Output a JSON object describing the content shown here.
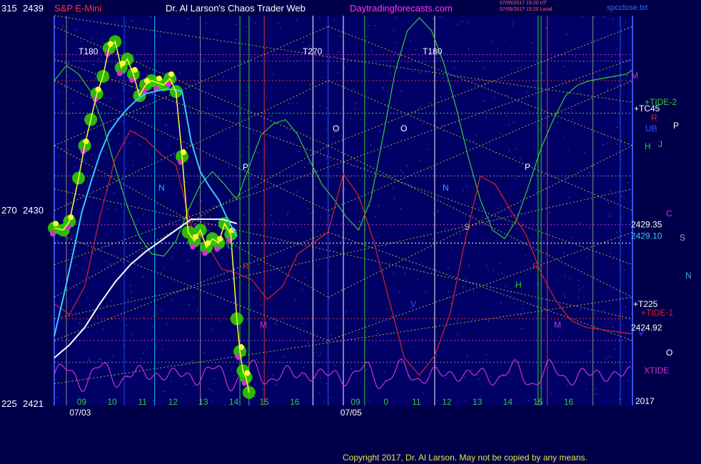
{
  "header": {
    "left_axis_top": "315",
    "price_top": "2439",
    "instrument": "S&P E-Mini",
    "title": "Dr. Al Larson's Chaos Trader Web",
    "site": "Daytradingforecasts.com",
    "timestamp_line1": "07/05/2017 19:20 UT",
    "timestamp_line2": "07/05/2017 15:20 Local",
    "filename": "spcclose.txt"
  },
  "footer": {
    "copyright": "Copyright 2017, Dr. Al Larson. May not be copied by any means.",
    "year": "2017"
  },
  "colors": {
    "background": "#00004a",
    "plot_bg": "#000066",
    "price_fill": "#33cc00",
    "price_line": "#ffff33",
    "avg_line": "#33ccff",
    "envelope": "#ffffff",
    "forecast": "#33cc33",
    "red_line": "#dd2222",
    "xtide": "#cc33cc",
    "grid_yellow": "#dddd22"
  },
  "chart_data": {
    "type": "line",
    "x_labels": [
      "09",
      "10",
      "11",
      "12",
      "13",
      "14",
      "15",
      "16",
      "09",
      "0",
      "11",
      "12",
      "13",
      "14",
      "15",
      "16"
    ],
    "date_labels": [
      "07/03",
      "07/05"
    ],
    "ylim": [
      2421,
      2439
    ],
    "left_axis": {
      "top": "315",
      "mid": "270",
      "bottom": "225"
    },
    "y_ticks": [
      {
        "value": 2439,
        "label": "2439",
        "left": "315"
      },
      {
        "value": 2430,
        "label": "2430",
        "left": "270"
      },
      {
        "value": 2421,
        "label": "2421",
        "left": "225"
      }
    ],
    "price_levels": [
      {
        "value": 2429.35,
        "label": "2429.35",
        "color": "#ffffff"
      },
      {
        "value": 2429.1,
        "label": "2429.10",
        "color": "#33ccff"
      },
      {
        "value": 2424.92,
        "label": "2424.92",
        "color": "#ffffff"
      }
    ],
    "right_labels": [
      {
        "text": "M",
        "color": "#cc33cc"
      },
      {
        "text": "+TIDE-2",
        "color": "#33cc33"
      },
      {
        "text": "+TC45",
        "color": "#ffffff"
      },
      {
        "text": "R",
        "color": "#dd2222"
      },
      {
        "text": "UB",
        "color": "#3355ff"
      },
      {
        "text": "P",
        "color": "#ffffff"
      },
      {
        "text": "H",
        "color": "#33cc33"
      },
      {
        "text": "J",
        "color": "#33cc33"
      },
      {
        "text": "C",
        "color": "#cc33cc"
      },
      {
        "text": "S",
        "color": "#aaaaaa"
      },
      {
        "text": "N",
        "color": "#33aaff"
      },
      {
        "text": "+T225",
        "color": "#ffffff"
      },
      {
        "text": "+TIDE-1",
        "color": "#dd2222"
      },
      {
        "text": "V",
        "color": "#3355ff"
      },
      {
        "text": "O",
        "color": "#ffffff"
      },
      {
        "text": "XTIDE",
        "color": "#cc33cc"
      }
    ],
    "plot_labels": [
      {
        "text": "T180",
        "color": "#ffffff"
      },
      {
        "text": "T270",
        "color": "#ffffff"
      },
      {
        "text": "T180",
        "color": "#ffffff"
      },
      {
        "text": "O",
        "color": "#ffffff"
      },
      {
        "text": "O",
        "color": "#ffffff"
      },
      {
        "text": "N",
        "color": "#33aaff"
      },
      {
        "text": "N",
        "color": "#33aaff"
      },
      {
        "text": "P",
        "color": "#ffffff"
      },
      {
        "text": "P",
        "color": "#ffffff"
      },
      {
        "text": "S",
        "color": "#aaaaaa"
      },
      {
        "text": "R",
        "color": "#dd2222"
      },
      {
        "text": "R",
        "color": "#dd2222"
      },
      {
        "text": "M",
        "color": "#cc33cc"
      },
      {
        "text": "M",
        "color": "#cc33cc"
      },
      {
        "text": "H",
        "color": "#33cc33"
      },
      {
        "text": "U",
        "color": "#33cc33"
      },
      {
        "text": "V",
        "color": "#3355ff"
      }
    ],
    "series": [
      {
        "key": "price",
        "x": [
          0.0,
          0.3,
          0.5,
          0.8,
          1.0,
          1.2,
          1.4,
          1.6,
          1.8,
          2.0,
          2.2,
          2.4,
          2.6,
          2.8,
          3.0,
          3.2,
          3.4,
          3.6,
          3.8,
          4.0,
          4.2,
          4.4,
          4.6,
          4.8,
          5.0,
          5.2,
          5.4,
          5.6,
          5.8,
          6.0,
          6.1,
          6.2,
          6.3,
          6.4
        ],
        "y": [
          2429.2,
          2429.1,
          2429.5,
          2431.5,
          2433.0,
          2434.2,
          2435.4,
          2436.2,
          2437.5,
          2437.8,
          2436.6,
          2437.0,
          2436.3,
          2435.3,
          2435.8,
          2436.0,
          2435.9,
          2435.8,
          2436.1,
          2435.5,
          2432.5,
          2429.0,
          2428.6,
          2429.1,
          2428.3,
          2428.7,
          2428.5,
          2429.4,
          2428.9,
          2425.0,
          2423.5,
          2422.6,
          2422.3,
          2421.6
        ]
      },
      {
        "key": "average",
        "x": [
          0.0,
          0.3,
          0.6,
          0.9,
          1.2,
          1.5,
          1.8,
          2.1,
          2.4,
          2.7,
          3.0,
          3.3,
          3.6,
          3.9,
          4.2,
          4.5,
          4.8,
          5.1,
          5.4,
          5.7,
          6.0
        ],
        "y": [
          2424.2,
          2426.0,
          2427.9,
          2429.9,
          2431.3,
          2432.6,
          2433.6,
          2434.2,
          2434.7,
          2435.1,
          2435.4,
          2435.5,
          2435.6,
          2435.6,
          2435.5,
          2433.2,
          2431.8,
          2431.1,
          2430.5,
          2429.6,
          2428.8
        ]
      },
      {
        "key": "envelope",
        "x": [
          0.0,
          0.5,
          1.0,
          1.5,
          2.0,
          2.5,
          3.0,
          3.5,
          4.0,
          4.5,
          5.0,
          5.5,
          6.0
        ],
        "y": [
          2423.2,
          2423.8,
          2424.6,
          2425.7,
          2426.7,
          2427.5,
          2428.1,
          2428.6,
          2429.1,
          2429.6,
          2429.6,
          2429.6,
          2429.4
        ]
      },
      {
        "key": "forecast",
        "x": [
          0.0,
          0.4,
          0.8,
          1.2,
          1.6,
          2.0,
          2.4,
          2.8,
          3.2,
          3.6,
          4.0,
          4.4,
          4.8,
          5.2,
          5.6,
          6.0,
          6.4,
          6.8,
          7.2,
          7.6,
          8.0,
          8.4,
          8.8,
          9.2,
          9.6,
          10.0,
          10.4,
          10.8,
          11.2,
          11.6,
          12.0,
          12.4,
          12.8,
          13.2,
          13.6,
          14.0,
          14.4,
          14.8,
          15.2,
          15.6,
          16.0,
          16.4,
          16.8,
          17.2,
          17.6,
          18.0,
          18.4,
          18.8,
          19.0
        ],
        "y": [
          2436,
          2436.7,
          2436.3,
          2435.5,
          2434.0,
          2432.0,
          2430.2,
          2428.8,
          2428.0,
          2427.9,
          2428.6,
          2430.0,
          2431.2,
          2431.8,
          2431.2,
          2430.5,
          2432.0,
          2433.5,
          2434.0,
          2434.2,
          2433.5,
          2432.3,
          2431.2,
          2430.5,
          2429.7,
          2429.1,
          2430.5,
          2433.4,
          2436.4,
          2438.3,
          2438.9,
          2438.3,
          2436.8,
          2434.8,
          2432.5,
          2430.5,
          2429.1,
          2428.7,
          2429.6,
          2431.2,
          2432.9,
          2434.2,
          2435.3,
          2435.8,
          2436.0,
          2436.1,
          2436.2,
          2436.3,
          2436.5
        ]
      },
      {
        "key": "tide",
        "x": [
          0.0,
          0.5,
          1.0,
          1.5,
          2.0,
          2.5,
          3.0,
          3.5,
          4.0,
          4.5,
          5.0,
          5.5,
          6.0,
          6.5,
          7.0,
          7.5,
          8.0,
          8.5,
          9.0,
          9.5,
          10.0,
          10.5,
          11.0,
          11.5,
          12.0,
          12.5,
          13.0,
          13.5,
          14.0,
          14.5,
          15.0,
          15.5,
          16.0,
          16.5,
          17.0,
          17.5,
          18.0,
          18.5,
          19.0
        ],
        "y": [
          2425.7,
          2425.2,
          2426.5,
          2429.7,
          2432.4,
          2433.7,
          2433.3,
          2432.6,
          2432.1,
          2429.3,
          2428.5,
          2427.3,
          2427.1,
          2426.8,
          2425.9,
          2426.5,
          2428.0,
          2428.5,
          2429.0,
          2431.7,
          2430.7,
          2428.6,
          2425.9,
          2423.2,
          2422.4,
          2423.3,
          2425.2,
          2428.6,
          2431.6,
          2431.2,
          2430.0,
          2428.9,
          2427.1,
          2425.8,
          2424.9,
          2424.6,
          2424.5,
          2424.4,
          2424.3
        ]
      }
    ]
  }
}
